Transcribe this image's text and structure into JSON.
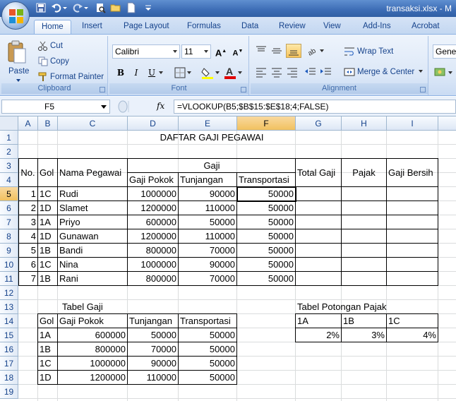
{
  "title": "transaksi.xlsx - M",
  "tabs": [
    "Home",
    "Insert",
    "Page Layout",
    "Formulas",
    "Data",
    "Review",
    "View",
    "Add-Ins",
    "Acrobat"
  ],
  "clipboard": {
    "paste": "Paste",
    "cut": "Cut",
    "copy": "Copy",
    "format_painter": "Format Painter",
    "label": "Clipboard"
  },
  "font": {
    "name": "Calibri",
    "size": "11",
    "label": "Font"
  },
  "alignment": {
    "wrap": "Wrap Text",
    "merge": "Merge & Center",
    "label": "Alignment"
  },
  "number": {
    "format": "Gener"
  },
  "namebox": "F5",
  "fx": "fx",
  "formula": "=VLOOKUP(B5;$B$15:$E$18;4;FALSE)",
  "columns": [
    "A",
    "B",
    "C",
    "D",
    "E",
    "F",
    "G",
    "H",
    "I"
  ],
  "rows": [
    "1",
    "2",
    "3",
    "4",
    "5",
    "6",
    "7",
    "8",
    "9",
    "10",
    "11",
    "12",
    "13",
    "14",
    "15",
    "16",
    "17",
    "18",
    "19"
  ],
  "sheet": {
    "title": "DAFTAR GAJI PEGAWAI",
    "hdr_no": "No.",
    "hdr_gol": "Gol",
    "hdr_nama": "Nama Pegawai",
    "hdr_gaji": "Gaji",
    "hdr_total": "Total Gaji",
    "hdr_pajak": "Pajak",
    "hdr_bersih": "Gaji Bersih",
    "hdr_pokok": "Gaji Pokok",
    "hdr_tunj": "Tunjangan",
    "hdr_transp": "Transportasi",
    "employees": [
      {
        "no": "1",
        "gol": "1C",
        "nama": "Rudi",
        "pokok": "1000000",
        "tunj": "90000",
        "transp": "50000"
      },
      {
        "no": "2",
        "gol": "1D",
        "nama": "Slamet",
        "pokok": "1200000",
        "tunj": "110000",
        "transp": "50000"
      },
      {
        "no": "3",
        "gol": "1A",
        "nama": "Priyo",
        "pokok": "600000",
        "tunj": "50000",
        "transp": "50000"
      },
      {
        "no": "4",
        "gol": "1D",
        "nama": "Gunawan",
        "pokok": "1200000",
        "tunj": "110000",
        "transp": "50000"
      },
      {
        "no": "5",
        "gol": "1B",
        "nama": "Bandi",
        "pokok": "800000",
        "tunj": "70000",
        "transp": "50000"
      },
      {
        "no": "6",
        "gol": "1C",
        "nama": "Nina",
        "pokok": "1000000",
        "tunj": "90000",
        "transp": "50000"
      },
      {
        "no": "7",
        "gol": "1B",
        "nama": "Rani",
        "pokok": "800000",
        "tunj": "70000",
        "transp": "50000"
      }
    ],
    "tabel_gaji": "Tabel Gaji",
    "tg_headers": [
      "Gol",
      "Gaji Pokok",
      "Tunjangan",
      "Transportasi"
    ],
    "tg_rows": [
      [
        "1A",
        "600000",
        "50000",
        "50000"
      ],
      [
        "1B",
        "800000",
        "70000",
        "50000"
      ],
      [
        "1C",
        "1000000",
        "90000",
        "50000"
      ],
      [
        "1D",
        "1200000",
        "110000",
        "50000"
      ]
    ],
    "tabel_pajak": "Tabel Potongan Pajak",
    "tp_headers": [
      "1A",
      "1B",
      "1C"
    ],
    "tp_values": [
      "2%",
      "3%",
      "4%"
    ]
  }
}
